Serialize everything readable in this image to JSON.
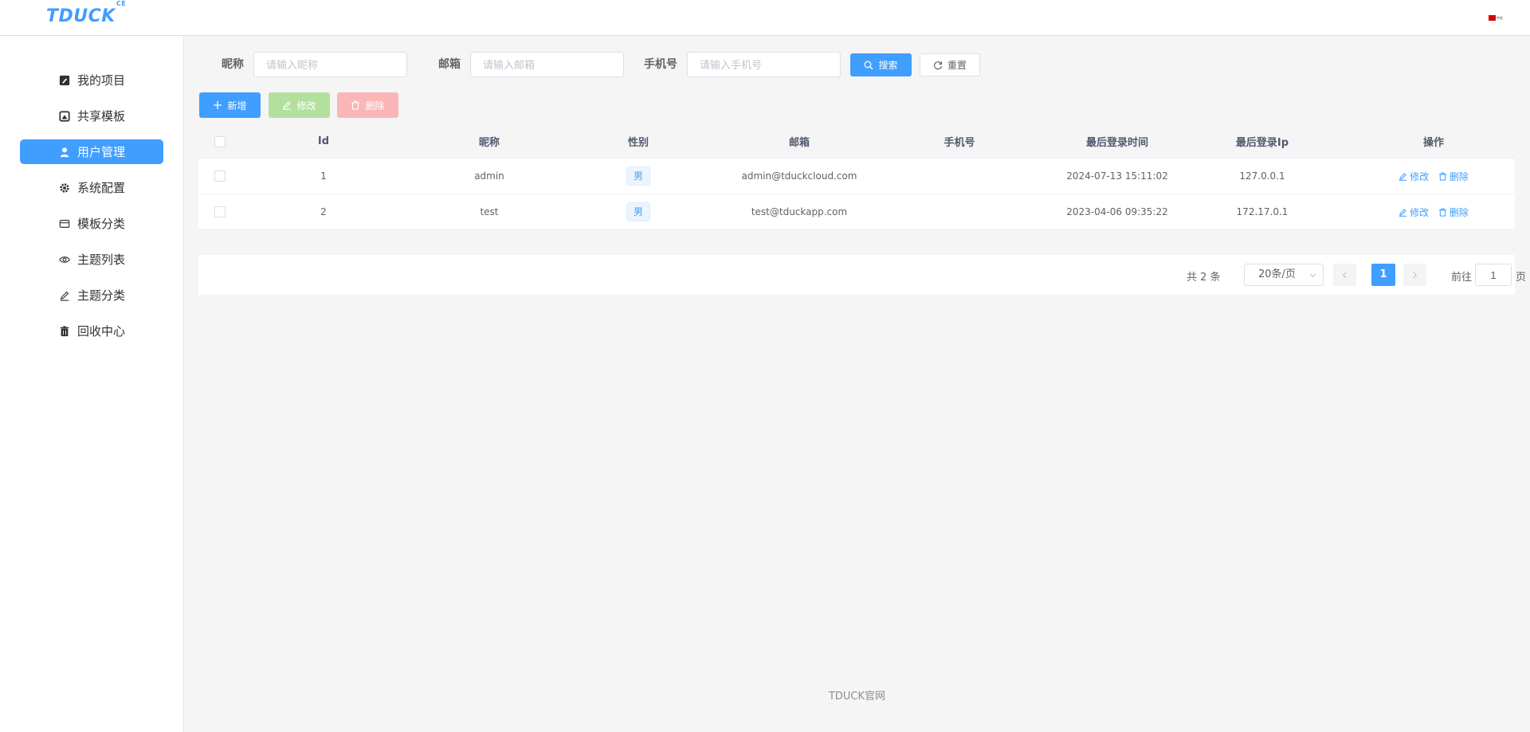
{
  "header": {
    "logo": "TDUCK",
    "logo_sup": "CE",
    "lang_label": "中文"
  },
  "sidebar": {
    "items": [
      {
        "label": "我的项目",
        "icon": "edit-square-icon",
        "active": false
      },
      {
        "label": "共享模板",
        "icon": "image-square-icon",
        "active": false
      },
      {
        "label": "用户管理",
        "icon": "user-icon",
        "active": true
      },
      {
        "label": "系统配置",
        "icon": "gear-icon",
        "active": false
      },
      {
        "label": "模板分类",
        "icon": "card-icon",
        "active": false
      },
      {
        "label": "主题列表",
        "icon": "eye-icon",
        "active": false
      },
      {
        "label": "主题分类",
        "icon": "pen-icon",
        "active": false
      },
      {
        "label": "回收中心",
        "icon": "trash-icon",
        "active": false
      }
    ]
  },
  "search": {
    "nickname_label": "昵称",
    "nickname_placeholder": "请输入昵称",
    "email_label": "邮箱",
    "email_placeholder": "请输入邮箱",
    "phone_label": "手机号",
    "phone_placeholder": "请输入手机号",
    "search_button": "搜索",
    "reset_button": "重置"
  },
  "toolbar": {
    "add_button": "新增",
    "edit_button": "修改",
    "delete_button": "删除"
  },
  "table": {
    "columns": [
      "Id",
      "昵称",
      "性别",
      "邮箱",
      "手机号",
      "最后登录时间",
      "最后登录Ip",
      "操作"
    ],
    "rows": [
      {
        "id": "1",
        "nickname": "admin",
        "gender": "男",
        "email": "admin@tduckcloud.com",
        "phone": "",
        "last_login_time": "2024-07-13 15:11:02",
        "last_login_ip": "127.0.0.1",
        "edit": "修改",
        "delete": "删除"
      },
      {
        "id": "2",
        "nickname": "test",
        "gender": "男",
        "email": "test@tduckapp.com",
        "phone": "",
        "last_login_time": "2023-04-06 09:35:22",
        "last_login_ip": "172.17.0.1",
        "edit": "修改",
        "delete": "删除"
      }
    ]
  },
  "pagination": {
    "total": "共 2 条",
    "page_size": "20条/页",
    "current_page": "1",
    "goto_label": "前往",
    "goto_value": "1",
    "page_suffix": "页"
  },
  "footer": {
    "text": "TDUCK官网"
  },
  "colors": {
    "primary": "#409eff",
    "success_disabled": "#b3e19d",
    "danger_disabled": "#fab6b6"
  }
}
